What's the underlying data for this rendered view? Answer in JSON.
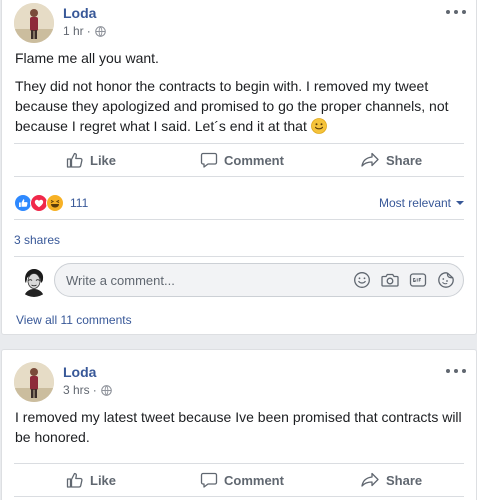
{
  "posts": [
    {
      "author": "Loda",
      "time": "1 hr",
      "separator": "·",
      "paragraphs": [
        "Flame me all you want.",
        "They did not honor the contracts to begin with. I removed my tweet because they apologized and promised to go the proper channels, not because I regret what I said. Let´s end it at that"
      ],
      "emoji": "smile-emoji",
      "actions": {
        "like": "Like",
        "comment": "Comment",
        "share": "Share"
      },
      "reactions": {
        "icons": [
          "like-reaction-icon",
          "love-reaction-icon",
          "haha-reaction-icon"
        ],
        "count": "111"
      },
      "sort_label": "Most relevant",
      "shares": "3 shares",
      "comment_box": {
        "placeholder": "Write a comment..."
      },
      "view_all": "View all 11 comments"
    },
    {
      "author": "Loda",
      "time": "3 hrs",
      "separator": "·",
      "paragraphs": [
        "I removed my latest tweet because Ive been promised that contracts will be honored."
      ],
      "actions": {
        "like": "Like",
        "comment": "Comment",
        "share": "Share"
      }
    }
  ],
  "colors": {
    "link": "#385898",
    "text": "#1c1e21",
    "meta": "#616770",
    "action": "#606770",
    "background": "#e9ebee"
  }
}
